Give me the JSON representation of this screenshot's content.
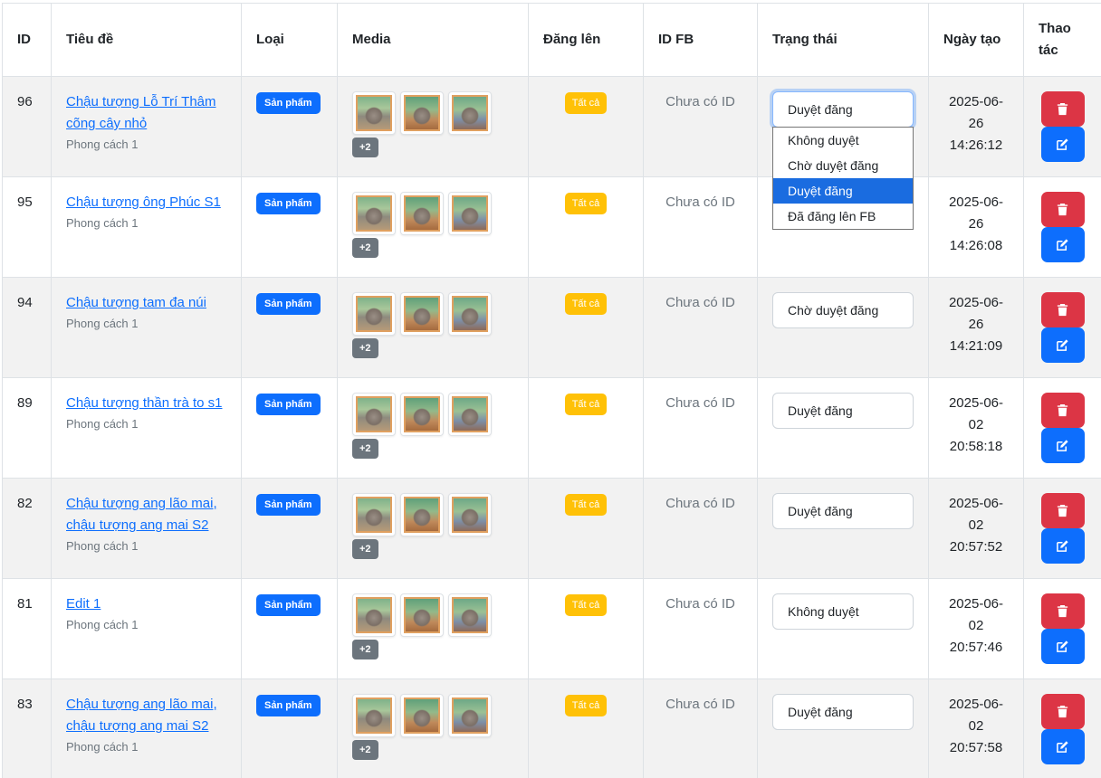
{
  "table": {
    "headers": {
      "id": "ID",
      "title": "Tiêu đề",
      "type": "Loại",
      "media": "Media",
      "post_to": "Đăng lên",
      "fb_id": "ID FB",
      "status": "Trạng thái",
      "created": "Ngày tạo",
      "actions": "Thao tác"
    },
    "status_options": [
      "Không duyệt",
      "Chờ duyệt đăng",
      "Duyệt đăng",
      "Đã đăng lên FB"
    ],
    "rows": [
      {
        "id": "96",
        "title": "Chậu tượng Lỗ Trí Thâm cõng cây nhỏ",
        "style": "Phong cách 1",
        "type": "Sản phẩm",
        "more": "+2",
        "post_to": "Tất cả",
        "fb_id": "Chưa có ID",
        "status": "Duyệt đăng",
        "date": "2025-06-",
        "date2": "26",
        "time": "14:26:12"
      },
      {
        "id": "95",
        "title": "Chậu tượng ông Phúc S1",
        "style": "Phong cách 1",
        "type": "Sản phẩm",
        "more": "+2",
        "post_to": "Tất cả",
        "fb_id": "Chưa có ID",
        "status": "",
        "date": "2025-06-",
        "date2": "26",
        "time": "14:26:08"
      },
      {
        "id": "94",
        "title": "Chậu tượng tam đa núi",
        "style": "Phong cách 1",
        "type": "Sản phẩm",
        "more": "+2",
        "post_to": "Tất cả",
        "fb_id": "Chưa có ID",
        "status": "Chờ duyệt đăng",
        "date": "2025-06-",
        "date2": "26",
        "time": "14:21:09"
      },
      {
        "id": "89",
        "title": "Chậu tượng thần trà to s1",
        "style": "Phong cách 1",
        "type": "Sản phẩm",
        "more": "+2",
        "post_to": "Tất cả",
        "fb_id": "Chưa có ID",
        "status": "Duyệt đăng",
        "date": "2025-06-",
        "date2": "02",
        "time": "20:58:18"
      },
      {
        "id": "82",
        "title": "Chậu tượng ang lão mai, chậu tượng ang mai S2",
        "style": "Phong cách 1",
        "type": "Sản phẩm",
        "more": "+2",
        "post_to": "Tất cả",
        "fb_id": "Chưa có ID",
        "status": "Duyệt đăng",
        "date": "2025-06-",
        "date2": "02",
        "time": "20:57:52"
      },
      {
        "id": "81",
        "title": "Edit 1",
        "style": "Phong cách 1",
        "type": "Sản phẩm",
        "more": "+2",
        "post_to": "Tất cả",
        "fb_id": "Chưa có ID",
        "status": "Không duyệt",
        "date": "2025-06-",
        "date2": "02",
        "time": "20:57:46"
      },
      {
        "id": "83",
        "title": "Chậu tượng ang lão mai, chậu tượng ang mai S2",
        "style": "Phong cách 1",
        "type": "Sản phẩm",
        "more": "+2",
        "post_to": "Tất cả",
        "fb_id": "Chưa có ID",
        "status": "Duyệt đăng",
        "date": "2025-06-",
        "date2": "02",
        "time": "20:57:58"
      }
    ]
  },
  "colors": {
    "primary": "#0d6efd",
    "danger": "#dc3545",
    "warning": "#ffc107",
    "secondary": "#6c757d",
    "dropdown_selected": "#1a6ce0"
  },
  "icons": {
    "delete": "trash-icon",
    "edit": "edit-icon"
  }
}
